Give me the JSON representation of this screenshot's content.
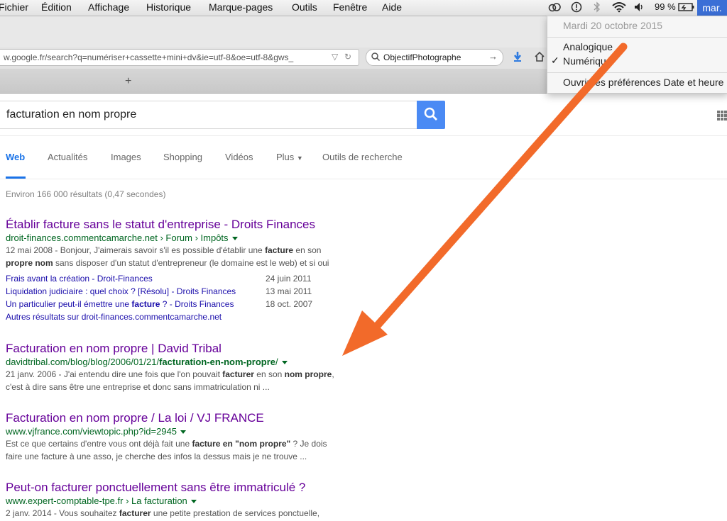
{
  "menubar": {
    "items": [
      "Fichier",
      "Édition",
      "Affichage",
      "Historique",
      "Marque-pages",
      "Outils",
      "Fenêtre",
      "Aide"
    ],
    "battery": "99 %",
    "clock": "mar."
  },
  "browser": {
    "url": "w.google.fr/search?q=numériser+cassette+mini+dv&ie=utf-8&oe=utf-8&gws_",
    "search_engine_text": "ObjectifPhotographe",
    "new_tab": "+"
  },
  "clock_menu": {
    "date": "Mardi 20 octobre 2015",
    "analog": "Analogique",
    "digital": "Numérique",
    "checkmark": "✓",
    "prefs": "Ouvrir les préférences Date et heure"
  },
  "google": {
    "query": "facturation en nom propre",
    "tabs": [
      "Web",
      "Actualités",
      "Images",
      "Shopping",
      "Vidéos",
      "Plus",
      "Outils de recherche"
    ],
    "stats": "Environ 166 000 résultats (0,47 secondes)"
  },
  "results": [
    {
      "title": "Établir facture sans le statut d'entreprise - Droits Finances",
      "url": "droit-finances.commentcamarche.net › Forum › Impôts",
      "snippet_line1_a": "12 mai 2008 - Bonjour, J'aimerais savoir s'il es possible d'établir une ",
      "snippet_line1_b": "facture",
      "snippet_line1_c": " en son",
      "snippet_line2_a": "propre nom",
      "snippet_line2_b": " sans disposer d'un statut d'entrepreneur (le domaine est le web) et si oui",
      "sitelinks": [
        {
          "label_a": "Frais avant la création - Droit-Finances",
          "label_b": "",
          "label_c": "",
          "date": "24 juin 2011"
        },
        {
          "label_a": "Liquidation judiciaire : quel choix ? [Résolu] - Droits Finances",
          "label_b": "",
          "label_c": "",
          "date": "13 mai 2011"
        },
        {
          "label_a": "Un particulier peut-il émettre une ",
          "label_b": "facture",
          "label_c": " ? - Droits Finances",
          "date": "18 oct. 2007"
        }
      ],
      "more": "Autres résultats sur droit-finances.commentcamarche.net"
    },
    {
      "title": "Facturation en nom propre | David Tribal",
      "url_a": "davidtribal.com/blog/blog/2006/01/21/",
      "url_b": "facturation-en-nom-propre",
      "url_c": "/",
      "snippet_line1_a": "21 janv. 2006 - J'ai entendu dire une fois que l'on pouvait ",
      "snippet_line1_b": "facturer",
      "snippet_line1_c": " en son ",
      "snippet_line1_d": "nom propre",
      "snippet_line1_e": ",",
      "snippet_line2": "c'est à dire sans être une entreprise et donc sans immatriculation ni ..."
    },
    {
      "title": "Facturation en nom propre / La loi / VJ FRANCE",
      "url": "www.vjfrance.com/viewtopic.php?id=2945",
      "snippet_line1_a": "Est ce que certains d'entre vous ont déjà fait une ",
      "snippet_line1_b": "facture en \"nom propre\"",
      "snippet_line1_c": " ? Je dois",
      "snippet_line2": "faire une facture à une asso, je cherche des infos la dessus mais je ne trouve ..."
    },
    {
      "title": "Peut-on facturer ponctuellement sans être immatriculé ?",
      "url": "www.expert-comptable-tpe.fr › La facturation",
      "snippet_line1_a": "2 janv. 2014 - Vous souhaitez ",
      "snippet_line1_b": "facturer",
      "snippet_line1_c": " une petite prestation de services ponctuelle,"
    }
  ],
  "colors": {
    "annotation_arrow": "#f26a2a",
    "link_visited": "#660099",
    "url_green": "#006621",
    "google_blue": "#4a8af4"
  }
}
